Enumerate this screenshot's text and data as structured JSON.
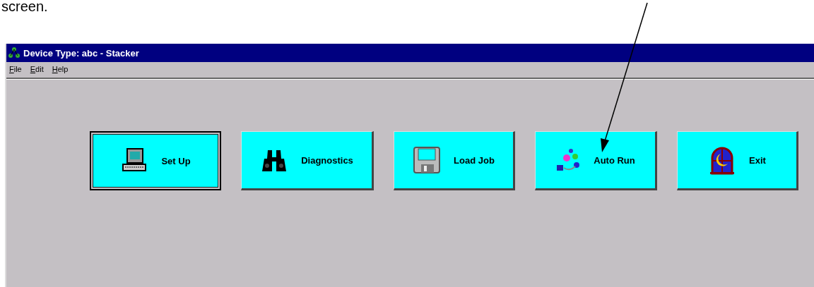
{
  "document_text": "screen.",
  "window": {
    "title": "Device Type: abc - Stacker"
  },
  "menu": [
    "File",
    "Edit",
    "Help"
  ],
  "buttons": [
    {
      "label": "Set Up",
      "focused": true
    },
    {
      "label": "Diagnostics",
      "focused": false
    },
    {
      "label": "Load Job",
      "focused": false
    },
    {
      "label": "Auto Run",
      "focused": false
    },
    {
      "label": "Exit",
      "focused": false
    }
  ]
}
